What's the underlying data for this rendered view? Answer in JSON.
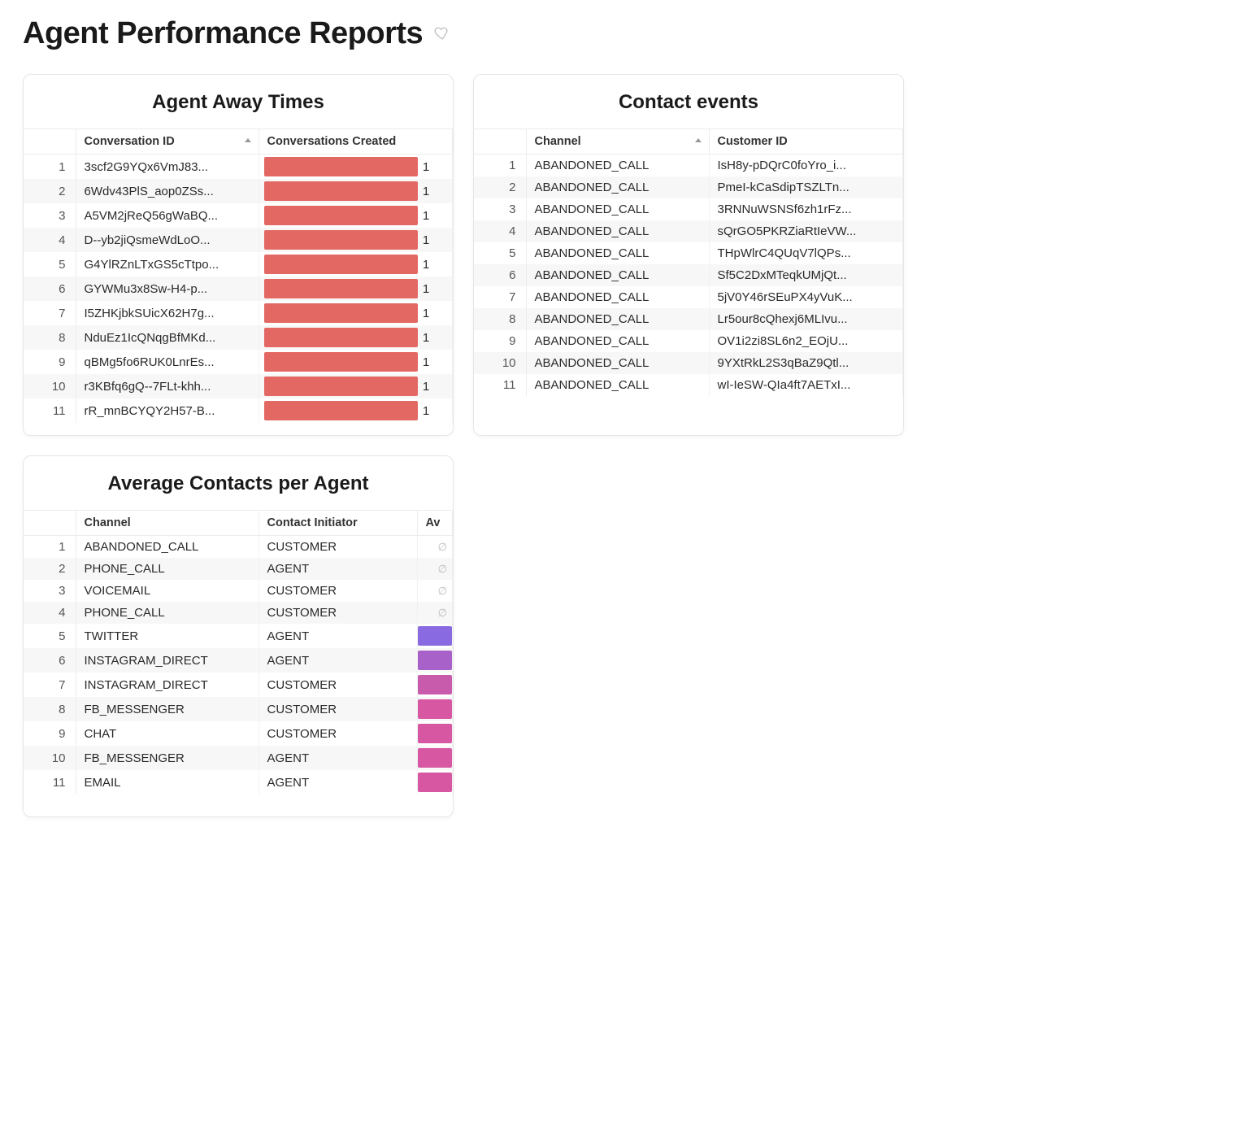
{
  "page": {
    "title": "Agent Performance Reports"
  },
  "cards": {
    "agent_away": {
      "title": "Agent Away Times",
      "columns": {
        "c1": "Conversation ID",
        "c2": "Conversations Created"
      },
      "rows": [
        {
          "conversation_id": "3scf2G9YQx6VmJ83...",
          "conversations_created": 1
        },
        {
          "conversation_id": "6Wdv43PlS_aop0ZSs...",
          "conversations_created": 1
        },
        {
          "conversation_id": "A5VM2jReQ56gWaBQ...",
          "conversations_created": 1
        },
        {
          "conversation_id": "D--yb2jiQsmeWdLoO...",
          "conversations_created": 1
        },
        {
          "conversation_id": "G4YlRZnLTxGS5cTtpo...",
          "conversations_created": 1
        },
        {
          "conversation_id": "GYWMu3x8Sw-H4-p...",
          "conversations_created": 1
        },
        {
          "conversation_id": "I5ZHKjbkSUicX62H7g...",
          "conversations_created": 1
        },
        {
          "conversation_id": "NduEz1IcQNqgBfMKd...",
          "conversations_created": 1
        },
        {
          "conversation_id": "qBMg5fo6RUK0LnrEs...",
          "conversations_created": 1
        },
        {
          "conversation_id": "r3KBfq6gQ--7FLt-khh...",
          "conversations_created": 1
        },
        {
          "conversation_id": "rR_mnBCYQY2H57-B...",
          "conversations_created": 1
        }
      ]
    },
    "contact_events": {
      "title": "Contact events",
      "columns": {
        "c1": "Channel",
        "c2": "Customer ID"
      },
      "rows": [
        {
          "channel": "ABANDONED_CALL",
          "customer_id": "IsH8y-pDQrC0foYro_i..."
        },
        {
          "channel": "ABANDONED_CALL",
          "customer_id": "PmeI-kCaSdipTSZLTn..."
        },
        {
          "channel": "ABANDONED_CALL",
          "customer_id": "3RNNuWSNSf6zh1rFz..."
        },
        {
          "channel": "ABANDONED_CALL",
          "customer_id": "sQrGO5PKRZiaRtIeVW..."
        },
        {
          "channel": "ABANDONED_CALL",
          "customer_id": "THpWlrC4QUqV7lQPs..."
        },
        {
          "channel": "ABANDONED_CALL",
          "customer_id": "Sf5C2DxMTeqkUMjQt..."
        },
        {
          "channel": "ABANDONED_CALL",
          "customer_id": "5jV0Y46rSEuPX4yVuK..."
        },
        {
          "channel": "ABANDONED_CALL",
          "customer_id": "Lr5our8cQhexj6MLIvu..."
        },
        {
          "channel": "ABANDONED_CALL",
          "customer_id": "OV1i2zi8SL6n2_EOjU..."
        },
        {
          "channel": "ABANDONED_CALL",
          "customer_id": "9YXtRkL2S3qBaZ9Qtl..."
        },
        {
          "channel": "ABANDONED_CALL",
          "customer_id": "wI-IeSW-QIa4ft7AETxI..."
        }
      ]
    },
    "avg_contacts": {
      "title": "Average Contacts per Agent",
      "columns": {
        "c1": "Channel",
        "c2": "Contact Initiator",
        "c3": "Av"
      },
      "rows": [
        {
          "channel": "ABANDONED_CALL",
          "initiator": "CUSTOMER",
          "bar": null
        },
        {
          "channel": "PHONE_CALL",
          "initiator": "AGENT",
          "bar": null
        },
        {
          "channel": "VOICEMAIL",
          "initiator": "CUSTOMER",
          "bar": null
        },
        {
          "channel": "PHONE_CALL",
          "initiator": "CUSTOMER",
          "bar": null
        },
        {
          "channel": "TWITTER",
          "initiator": "AGENT",
          "bar": "purple"
        },
        {
          "channel": "INSTAGRAM_DIRECT",
          "initiator": "AGENT",
          "bar": "violet"
        },
        {
          "channel": "INSTAGRAM_DIRECT",
          "initiator": "CUSTOMER",
          "bar": "pink"
        },
        {
          "channel": "FB_MESSENGER",
          "initiator": "CUSTOMER",
          "bar": "magenta"
        },
        {
          "channel": "CHAT",
          "initiator": "CUSTOMER",
          "bar": "magenta"
        },
        {
          "channel": "FB_MESSENGER",
          "initiator": "AGENT",
          "bar": "magenta"
        },
        {
          "channel": "EMAIL",
          "initiator": "AGENT",
          "bar": "magenta"
        }
      ]
    }
  },
  "chart_data": [
    {
      "type": "table",
      "title": "Agent Away Times",
      "columns": [
        "Conversation ID",
        "Conversations Created"
      ],
      "rows": [
        [
          "3scf2G9YQx6VmJ83...",
          1
        ],
        [
          "6Wdv43PlS_aop0ZSs...",
          1
        ],
        [
          "A5VM2jReQ56gWaBQ...",
          1
        ],
        [
          "D--yb2jiQsmeWdLoO...",
          1
        ],
        [
          "G4YlRZnLTxGS5cTtpo...",
          1
        ],
        [
          "GYWMu3x8Sw-H4-p...",
          1
        ],
        [
          "I5ZHKjbkSUicX62H7g...",
          1
        ],
        [
          "NduEz1IcQNqgBfMKd...",
          1
        ],
        [
          "qBMg5fo6RUK0LnrEs...",
          1
        ],
        [
          "r3KBfq6gQ--7FLt-khh...",
          1
        ],
        [
          "rR_mnBCYQY2H57-B...",
          1
        ]
      ]
    },
    {
      "type": "table",
      "title": "Contact events",
      "columns": [
        "Channel",
        "Customer ID"
      ],
      "rows": [
        [
          "ABANDONED_CALL",
          "IsH8y-pDQrC0foYro_i..."
        ],
        [
          "ABANDONED_CALL",
          "PmeI-kCaSdipTSZLTn..."
        ],
        [
          "ABANDONED_CALL",
          "3RNNuWSNSf6zh1rFz..."
        ],
        [
          "ABANDONED_CALL",
          "sQrGO5PKRZiaRtIeVW..."
        ],
        [
          "ABANDONED_CALL",
          "THpWlrC4QUqV7lQPs..."
        ],
        [
          "ABANDONED_CALL",
          "Sf5C2DxMTeqkUMjQt..."
        ],
        [
          "ABANDONED_CALL",
          "5jV0Y46rSEuPX4yVuK..."
        ],
        [
          "ABANDONED_CALL",
          "Lr5our8cQhexj6MLIvu..."
        ],
        [
          "ABANDONED_CALL",
          "OV1i2zi8SL6n2_EOjU..."
        ],
        [
          "ABANDONED_CALL",
          "9YXtRkL2S3qBaZ9Qtl..."
        ],
        [
          "ABANDONED_CALL",
          "wI-IeSW-QIa4ft7AETxI..."
        ]
      ]
    },
    {
      "type": "table",
      "title": "Average Contacts per Agent",
      "columns": [
        "Channel",
        "Contact Initiator"
      ],
      "rows": [
        [
          "ABANDONED_CALL",
          "CUSTOMER"
        ],
        [
          "PHONE_CALL",
          "AGENT"
        ],
        [
          "VOICEMAIL",
          "CUSTOMER"
        ],
        [
          "PHONE_CALL",
          "CUSTOMER"
        ],
        [
          "TWITTER",
          "AGENT"
        ],
        [
          "INSTAGRAM_DIRECT",
          "AGENT"
        ],
        [
          "INSTAGRAM_DIRECT",
          "CUSTOMER"
        ],
        [
          "FB_MESSENGER",
          "CUSTOMER"
        ],
        [
          "CHAT",
          "CUSTOMER"
        ],
        [
          "FB_MESSENGER",
          "AGENT"
        ],
        [
          "EMAIL",
          "AGENT"
        ]
      ]
    }
  ]
}
